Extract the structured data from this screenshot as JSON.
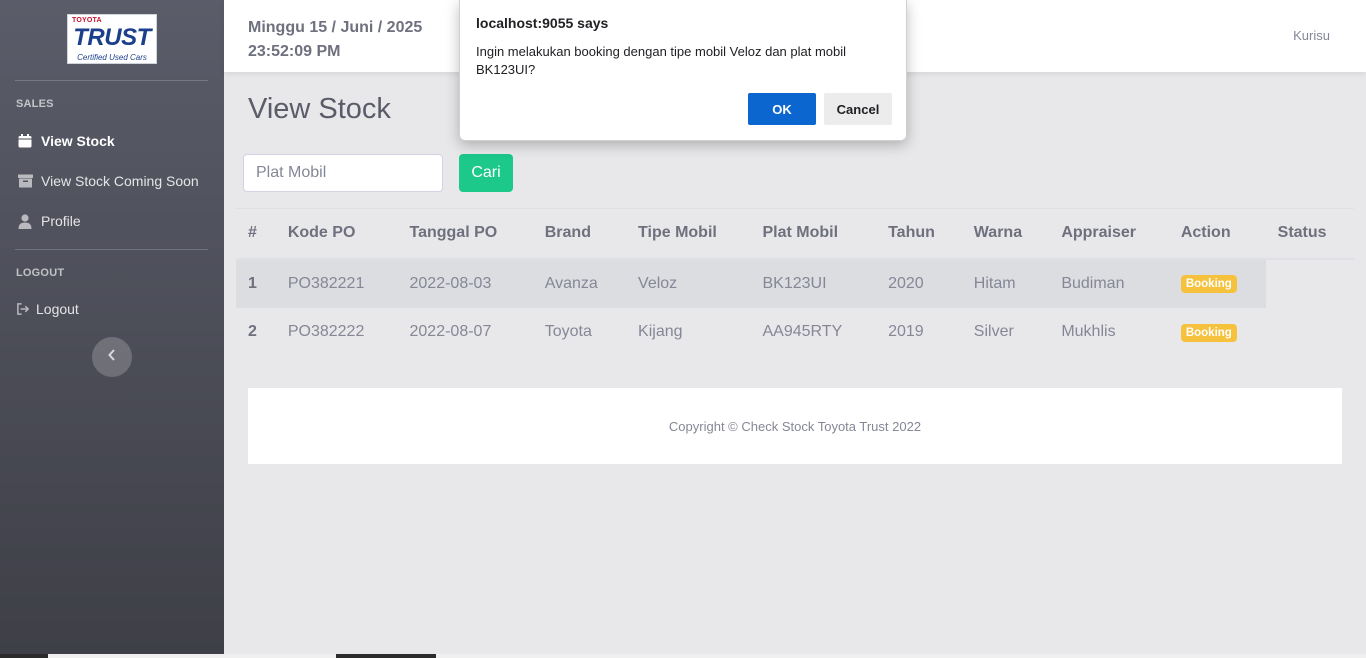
{
  "logo": {
    "brand": "TOYOTA",
    "name": "TRUST",
    "tagline": "Certified Used Cars"
  },
  "sidebar": {
    "sections": [
      {
        "heading": "SALES",
        "items": [
          {
            "label": "View Stock",
            "icon": "calendar-icon",
            "active": true
          },
          {
            "label": "View Stock Coming Soon",
            "icon": "archive-icon",
            "active": false
          },
          {
            "label": "Profile",
            "icon": "user-icon",
            "active": false
          }
        ]
      },
      {
        "heading": "LOGOUT",
        "items": [
          {
            "label": "Logout",
            "icon": "sign-out-icon",
            "active": false
          }
        ]
      }
    ],
    "collapse_icon": "chevron-left-icon"
  },
  "topbar": {
    "date": "Minggu 15 / Juni / 2025",
    "time": "23:52:09 PM",
    "user": "Kurisu"
  },
  "main": {
    "title": "View Stock",
    "search": {
      "placeholder": "Plat Mobil",
      "button_label": "Cari"
    },
    "table": {
      "columns": [
        "#",
        "Kode PO",
        "Tanggal PO",
        "Brand",
        "Tipe Mobil",
        "Plat Mobil",
        "Tahun",
        "Warna",
        "Appraiser",
        "Action",
        "Status"
      ],
      "rows": [
        {
          "no": "1",
          "kode_po": "PO382221",
          "tanggal_po": "2022-08-03",
          "brand": "Avanza",
          "tipe": "Veloz",
          "plat": "BK123UI",
          "tahun": "2020",
          "warna": "Hitam",
          "appraiser": "Budiman",
          "action": "Booking",
          "status": ""
        },
        {
          "no": "2",
          "kode_po": "PO382222",
          "tanggal_po": "2022-08-07",
          "brand": "Toyota",
          "tipe": "Kijang",
          "plat": "AA945RTY",
          "tahun": "2019",
          "warna": "Silver",
          "appraiser": "Mukhlis",
          "action": "Booking",
          "status": ""
        }
      ]
    },
    "footer": "Copyright © Check Stock Toyota Trust 2022"
  },
  "dialog": {
    "title": "localhost:9055 says",
    "message": "Ingin melakukan booking dengan tipe mobil Veloz dan plat mobil BK123UI?",
    "ok_label": "OK",
    "cancel_label": "Cancel"
  },
  "colors": {
    "sidebar_top": "#5a5c69",
    "sidebar_bottom": "#3e3f47",
    "search_button": "#1cc88a",
    "badge": "#f6c23e",
    "dialog_ok": "#0b66d0"
  }
}
